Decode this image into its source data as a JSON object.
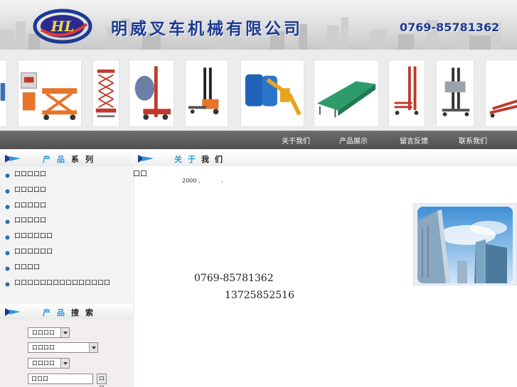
{
  "header": {
    "logo_letters": "HL",
    "company_name": "明威叉车机械有限公司",
    "phone": "0769-85781362"
  },
  "products_strip": {
    "items": [
      {
        "icon": "lift-table-cart-icon"
      },
      {
        "icon": "lift-table-icon"
      },
      {
        "icon": "scissor-lift-icon"
      },
      {
        "icon": "drum-stacker-icon"
      },
      {
        "icon": "electric-stacker-icon"
      },
      {
        "icon": "drum-handler-icon"
      },
      {
        "icon": "dock-ramp-icon"
      },
      {
        "icon": "manual-stacker-icon"
      },
      {
        "icon": "drum-lifter-icon"
      },
      {
        "icon": "pallet-truck-icon"
      }
    ]
  },
  "nav": {
    "items": [
      {
        "label": "关于我们"
      },
      {
        "label": "产品展示"
      },
      {
        "label": "留言反馈"
      },
      {
        "label": "联系我们"
      }
    ]
  },
  "sidebar": {
    "products_title_a": "产品",
    "products_title_b": "系列",
    "categories": [
      {
        "label": "口口口口口"
      },
      {
        "label": "口口口口口"
      },
      {
        "label": "口口口口口"
      },
      {
        "label": "口口口口口"
      },
      {
        "label": "口口口口口口"
      },
      {
        "label": "口口口口口口"
      },
      {
        "label": "口口口口"
      },
      {
        "label": "口口口口口口口口口口口口口口口"
      }
    ],
    "search_title_a": "产品",
    "search_title_b": "搜索",
    "search": {
      "select1": "口口口口",
      "select2": "口口口口",
      "select3": "口口口口",
      "keyword": "口口口",
      "go": "口口"
    }
  },
  "main": {
    "title_a": "关于",
    "title_b": "我们",
    "about_label": "口口",
    "year": "2000",
    "dot1": ",",
    "dot2": ".",
    "tel": "0769-85781362",
    "mobile": "13725852516"
  },
  "colors": {
    "brand_blue": "#1d3a92",
    "accent_blue": "#2a97d9",
    "nav_gray": "#5a5a5a"
  }
}
